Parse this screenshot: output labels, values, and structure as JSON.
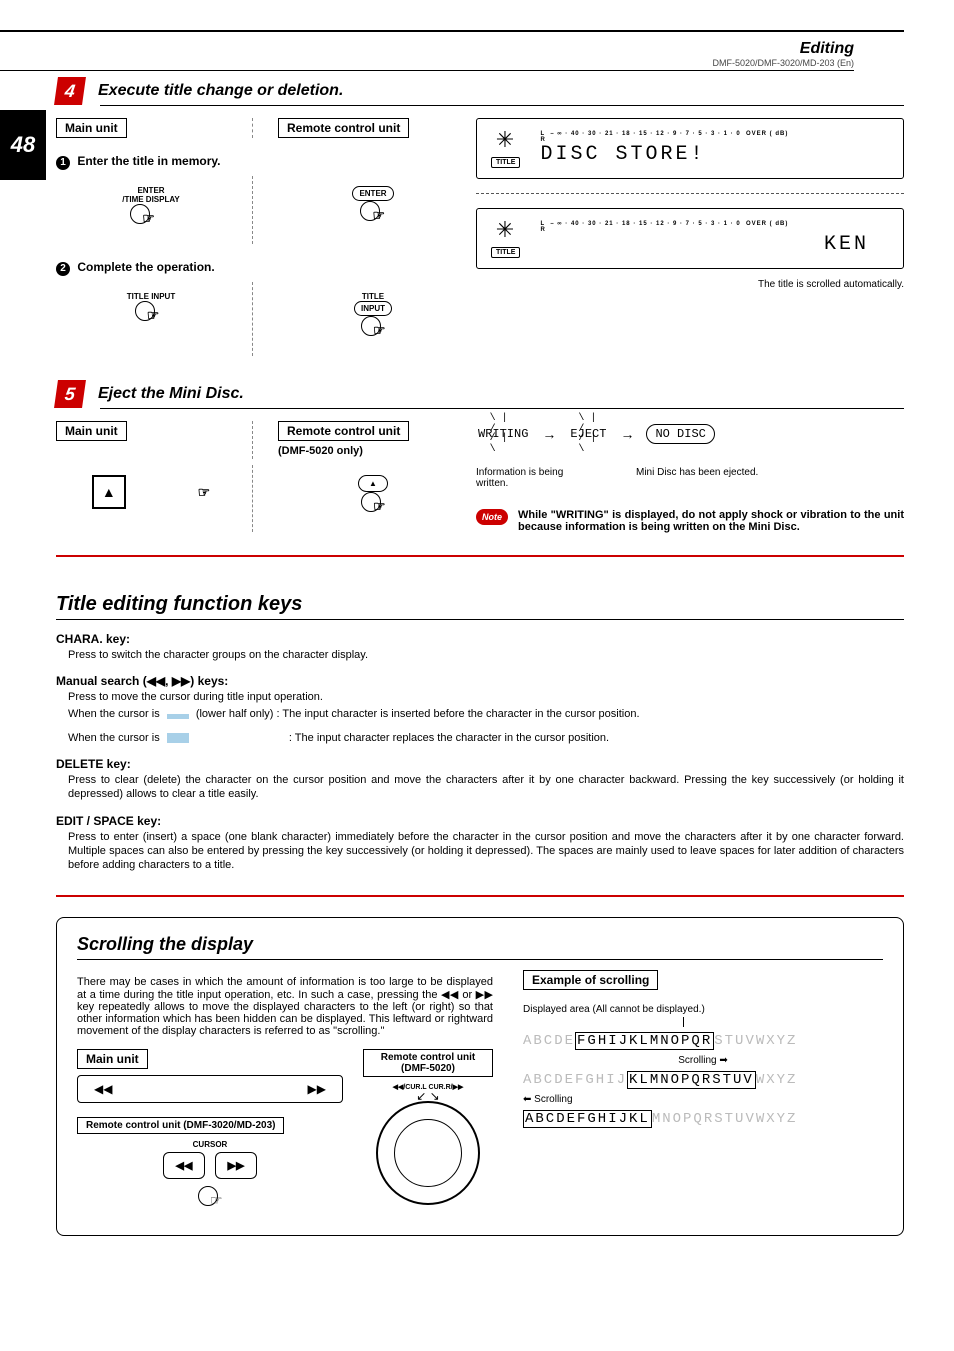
{
  "header": {
    "section": "Editing",
    "models": "DMF-5020/DMF-3020/MD-203 (En)",
    "pageNumber": "48"
  },
  "step4": {
    "num": "4",
    "title": "Execute title change or deletion.",
    "mainUnit": "Main unit",
    "remoteUnit": "Remote control unit",
    "sub1": "Enter the title in memory.",
    "sub2": "Complete the operation.",
    "enterTime": "ENTER\n/TIME DISPLAY",
    "enterBtn": "ENTER",
    "titleInput": "TITLE INPUT",
    "titleBtn": "TITLE",
    "inputBtn": "INPUT",
    "vu": "L  – ∞ · 40 · 30 · 21 · 18 · 15 · 12 · 9 · 7 · 5 · 3 · 1 · 0  OVER ( dB)\nR",
    "titleLabel": "TITLE",
    "lcd1": "DISC STORE!",
    "lcd2": "KEN",
    "autoScroll": "The title is scrolled automatically."
  },
  "step5": {
    "num": "5",
    "title": "Eject the Mini Disc.",
    "mainUnit": "Main unit",
    "remoteUnit": "Remote control unit",
    "remoteSub": "(DMF-5020 only)",
    "writing": "WRITING",
    "eject": "EJECT",
    "noDisc": "NO DISC",
    "writingCap": "Information is being written.",
    "ejectCap": "Mini Disc has been ejected.",
    "noteLabel": "Note",
    "noteText": "While \"WRITING\" is displayed, do not apply shock or vibration to the unit because information is being written on the Mini Disc."
  },
  "titleKeys": {
    "heading": "Title editing function keys",
    "chara": {
      "name": "CHARA. key:",
      "desc": "Press to switch the character groups on the character display."
    },
    "manual": {
      "name": "Manual search (◀◀, ▶▶) keys:",
      "l1": "Press to move the cursor during title input operation.",
      "l2a": "When the cursor is",
      "l2b": "(lower half only)   : The input character is inserted before the character in the cursor position.",
      "l3a": "When the cursor is",
      "l3b": ": The input character replaces the character in the cursor position."
    },
    "delete": {
      "name": "DELETE key:",
      "desc": "Press to clear (delete) the character on the cursor position and move the characters after it by one character backward. Pressing the key successively (or holding it depressed) allows to clear a title easily."
    },
    "edit": {
      "name": "EDIT / SPACE key:",
      "desc": "Press to enter (insert) a space (one blank character) immediately before the character in the cursor position and move the characters after it by one character forward. Multiple spaces can also be entered by pressing the key successively (or holding it depressed). The spaces are mainly used to leave spaces for later addition of characters before adding characters to a title."
    }
  },
  "scroll": {
    "heading": "Scrolling the display",
    "para": "There may be cases in which the amount of information is too large to be displayed at a time during the title input operation, etc. In such a case, pressing the ◀◀ or ▶▶ key repeatedly allows to move the displayed characters to the left (or right) so that other information which has been hidden can be displayed. This leftward or rightward movement of the display characters is referred to as \"scrolling.\"",
    "mainUnit": "Main unit",
    "remote1": "Remote control unit (DMF-3020/MD-203)",
    "cursorLabel": "CURSOR",
    "remote2": "Remote control unit (DMF-5020)",
    "curLabels": "◀◀/CUR.L        CUR.R/▶▶",
    "example": "Example of scrolling",
    "displayed": "Displayed area (All cannot be displayed.)",
    "row1_out1": "ABCDE",
    "row1_in": "FGHIJKLMNOPQR",
    "row1_out2": "STUVWXYZ",
    "scrollR": "Scrolling ➡",
    "row2_out1": "ABCDEFGHIJ",
    "row2_in": "KLMNOPQRSTUV",
    "row2_out2": "WXYZ",
    "scrollL": "⬅ Scrolling",
    "row3_in": "ABCDEFGHIJKL",
    "row3_out": "MNOPQRSTUVWXYZ"
  }
}
